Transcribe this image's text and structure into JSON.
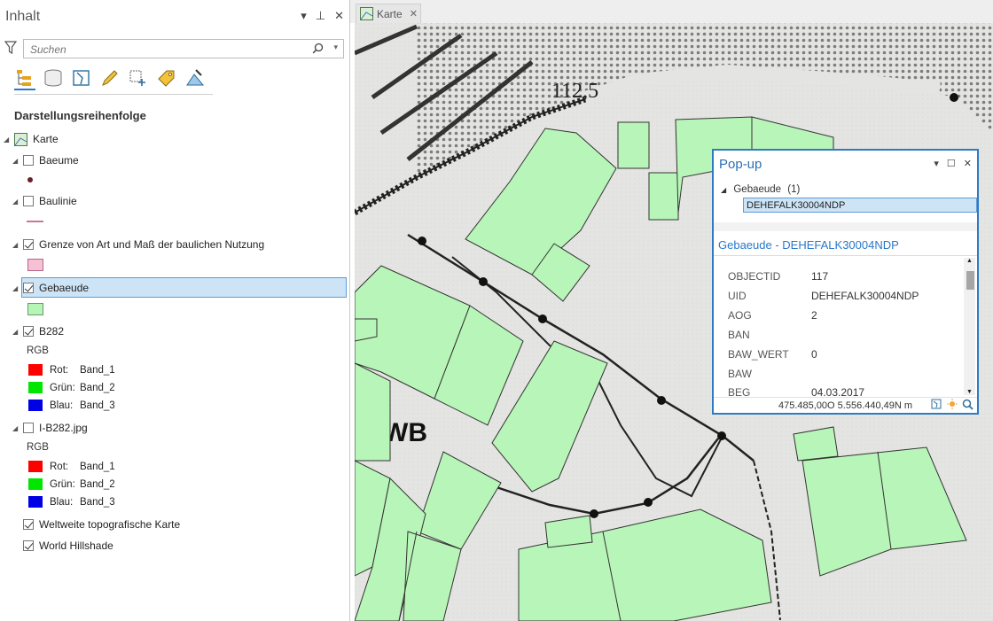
{
  "contents_pane": {
    "title": "Inhalt",
    "search_placeholder": "Suchen",
    "view_icons": [
      "list-by-drawing-order-icon",
      "list-by-source-icon",
      "list-by-selection-icon",
      "list-by-editing-icon",
      "list-by-snapping-icon",
      "list-by-labeling-icon",
      "list-by-perspective-imagery-icon"
    ],
    "heading": "Darstellungsreihenfolge",
    "map_name": "Karte",
    "layers": [
      {
        "name": "Baeume",
        "checked": false
      },
      {
        "name": "Baulinie",
        "checked": false
      },
      {
        "name": "Grenze von Art und Maß der baulichen Nutzung",
        "checked": true
      },
      {
        "name": "Gebaeude",
        "checked": true,
        "selected": true
      },
      {
        "name": "B282",
        "checked": true
      },
      {
        "name": "I-B282.jpg",
        "checked": false
      },
      {
        "name": "Weltweite topografische Karte",
        "checked": true
      },
      {
        "name": "World Hillshade",
        "checked": true
      }
    ],
    "rgb_groups": [
      {
        "label": "RGB",
        "bands": [
          {
            "key": "Rot:",
            "value": "Band_1",
            "color": "#ff0000"
          },
          {
            "key": "Grün:",
            "value": "Band_2",
            "color": "#00e600"
          },
          {
            "key": "Blau:",
            "value": "Band_3",
            "color": "#0000e6"
          }
        ]
      },
      {
        "label": "RGB",
        "bands": [
          {
            "key": "Rot:",
            "value": "Band_1",
            "color": "#ff0000"
          },
          {
            "key": "Grün:",
            "value": "Band_2",
            "color": "#00e600"
          },
          {
            "key": "Blau:",
            "value": "Band_3",
            "color": "#0000e6"
          }
        ]
      }
    ],
    "colors": {
      "grenze_fill": "#f8c0d4",
      "gebaeude_fill": "#b5f5b5",
      "baeume_point": "#6b1f2a",
      "baulinie_line": "#c87890",
      "selection": "#cde4f7",
      "accent": "#2a78c9"
    }
  },
  "map_view": {
    "tab_label": "Karte",
    "map_text_1": "112,5",
    "map_text_2": "WB",
    "building_fill": "#b8f5b8"
  },
  "popup": {
    "title": "Pop-up",
    "layer": "Gebaeude",
    "count": "(1)",
    "selected_feature": "DEHEFALK30004NDP",
    "feature_header": "Gebaeude - DEHEFALK30004NDP",
    "attributes": [
      {
        "key": "OBJECTID",
        "value": "117"
      },
      {
        "key": "UID",
        "value": "DEHEFALK30004NDP"
      },
      {
        "key": "AOG",
        "value": "2"
      },
      {
        "key": "BAN",
        "value": ""
      },
      {
        "key": "BAW_WERT",
        "value": "0"
      },
      {
        "key": "BAW",
        "value": ""
      },
      {
        "key": "BEG",
        "value": "04.03.2017"
      }
    ],
    "coordinates": "475.485,00O 5.556.440,49N m"
  }
}
